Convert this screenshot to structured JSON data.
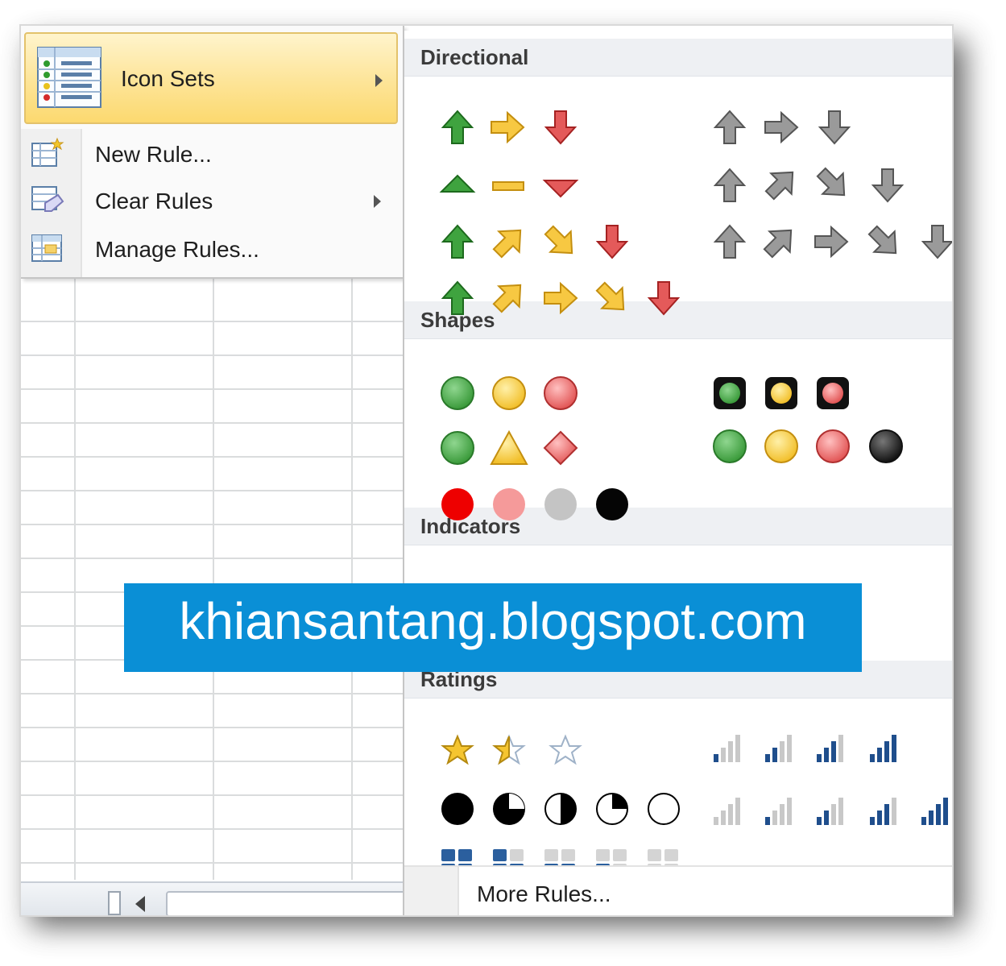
{
  "menu": {
    "icon_sets": {
      "label": "Icon Sets",
      "icon": "icon-sets-icon"
    },
    "items": [
      {
        "label": "New Rule...",
        "icon": "new-rule-icon",
        "submenu": false
      },
      {
        "label": "Clear Rules",
        "icon": "clear-rules-icon",
        "submenu": true
      },
      {
        "label": "Manage Rules...",
        "icon": "manage-rules-icon",
        "submenu": false
      }
    ]
  },
  "gallery": {
    "sections": [
      {
        "title": "Directional"
      },
      {
        "title": "Shapes"
      },
      {
        "title": "Indicators"
      },
      {
        "title": "Ratings"
      }
    ],
    "more_rules": "More Rules..."
  },
  "watermark": "khiansantang.blogspot.com",
  "colors": {
    "accent_highlight": "#fde497",
    "green": "#3a9a3a",
    "yellow": "#f5c530",
    "red": "#e04b4b",
    "gray": "#8a8a8a",
    "banner": "#0a8fd6",
    "bar_blue": "#1f4e8c"
  }
}
